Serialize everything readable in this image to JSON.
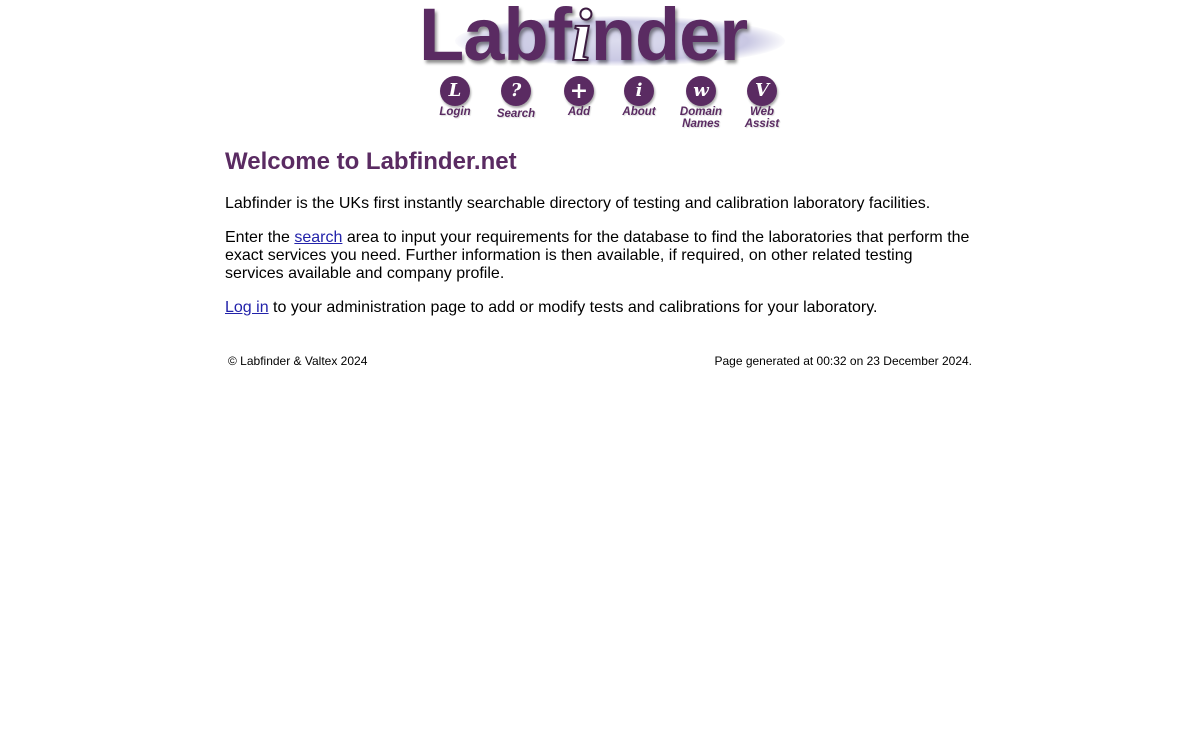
{
  "logo": {
    "text_before": "Labf",
    "text_i": "i",
    "text_after": "nder"
  },
  "nav": [
    {
      "label": "Login",
      "icon_char": "L",
      "icon": "login-icon"
    },
    {
      "label": "Search",
      "icon_char": "?",
      "icon": "search-icon"
    },
    {
      "label": "Add",
      "icon_char": "+",
      "icon": "add-icon"
    },
    {
      "label": "About",
      "icon_char": "i",
      "icon": "about-icon"
    },
    {
      "label_line1": "Domain",
      "label_line2": "Names",
      "icon_char": "w",
      "icon": "domain-names-icon"
    },
    {
      "label_line1": "Web",
      "label_line2": "Assist",
      "icon_char": "V",
      "icon": "web-assist-icon"
    }
  ],
  "main": {
    "heading": "Welcome to Labfinder.net",
    "para1": "Labfinder is the UKs first instantly searchable directory of testing and calibration laboratory facilities.",
    "para2_before": "Enter the ",
    "para2_link": "search",
    "para2_after": " area to input your requirements for the database to find the laboratories that perform the exact services you need. Further information is then available, if required, on other related testing services available and company profile.",
    "para3_link": "Log in",
    "para3_after": " to your administration page to add or modify tests and calibrations for your laboratory."
  },
  "footer": {
    "copyright": "© Labfinder & Valtex 2024",
    "generated": "Page generated at 00:32 on 23 December 2024."
  },
  "colors": {
    "brand_purple": "#5a2b62",
    "link": "#2222aa"
  }
}
